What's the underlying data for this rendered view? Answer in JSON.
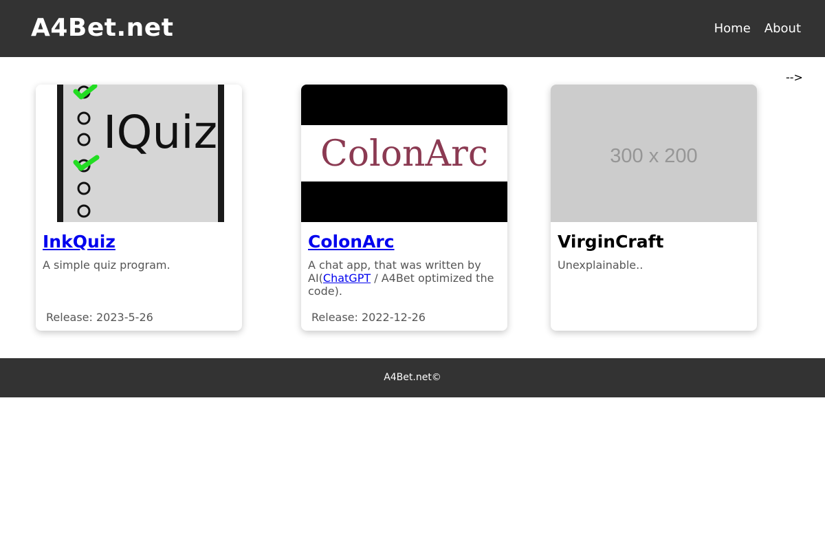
{
  "header": {
    "site_title": "A4Bet.net",
    "nav": [
      {
        "label": "Home"
      },
      {
        "label": "About"
      }
    ]
  },
  "stray_text": "-->",
  "cards": [
    {
      "title": "InkQuiz",
      "image_text": "IQuiz",
      "description": "A simple quiz program.",
      "release": "Release: 2023-5-26"
    },
    {
      "title": "ColonArc",
      "image_text": "ColonArc",
      "description_before": "A chat app, that was written by AI(",
      "description_link": "ChatGPT",
      "description_after": " / A4Bet optimized the code).",
      "release": "Release: 2022-12-26"
    },
    {
      "title": "VirginCraft",
      "image_text": "300 x 200",
      "description": "Unexplainable.."
    }
  ],
  "footer": {
    "text": "A4Bet.net©"
  },
  "colors": {
    "header_bg": "#333333",
    "footer_bg": "#333333",
    "link": "#0000ee",
    "colonarc_logo": "#8b3a52",
    "check_green": "#22dd22",
    "placeholder_bg": "#cccccc"
  }
}
